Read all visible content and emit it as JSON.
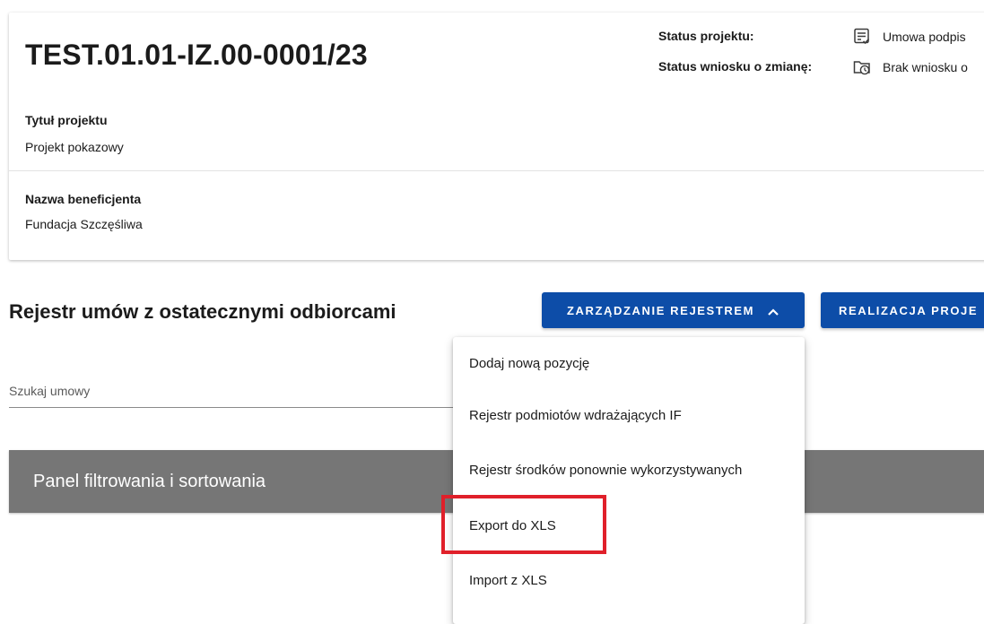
{
  "project": {
    "number": "TEST.01.01-IZ.00-0001/23",
    "status_label": "Status projektu:",
    "status_value": "Umowa podpis",
    "change_status_label": "Status wniosku o zmianę:",
    "change_status_value": "Brak wniosku o",
    "title_label": "Tytuł projektu",
    "title_value": "Projekt pokazowy",
    "beneficiary_label": "Nazwa beneficjenta",
    "beneficiary_value": "Fundacja Szczęśliwa"
  },
  "register": {
    "title": "Rejestr umów z ostatecznymi odbiorcami",
    "manage_button": "ZARZĄDZANIE REJESTREM",
    "realize_button": "REALIZACJA PROJE",
    "search_placeholder": "Szukaj umowy",
    "filter_panel": "Panel filtrowania i sortowania"
  },
  "menu": {
    "items": [
      {
        "label": "Dodaj nową pozycję"
      },
      {
        "label": "Rejestr podmiotów wdrażających IF"
      },
      {
        "label": "Rejestr środków ponownie wykorzystywanych"
      },
      {
        "label": "Export do XLS"
      },
      {
        "label": "Import z XLS"
      }
    ]
  },
  "icons": {
    "status": "document-check-icon",
    "change_status": "folder-clock-icon",
    "manage_chevron": "chevron-up-icon"
  },
  "colors": {
    "primary": "#0d4da8",
    "panel": "#767676",
    "highlight": "#e0202a"
  }
}
